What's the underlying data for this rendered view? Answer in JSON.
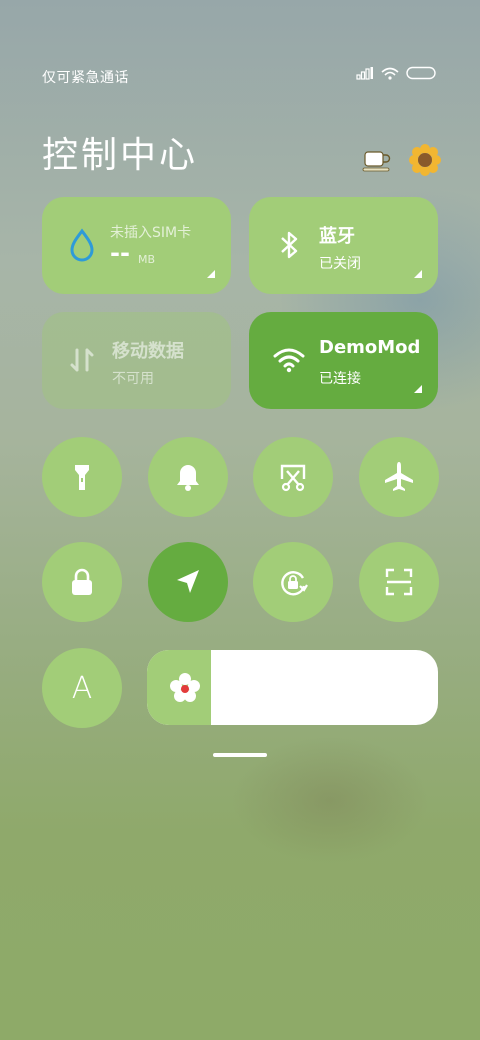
{
  "status_bar": {
    "carrier_text": "仅可紧急通话",
    "signal_icon": "signal-icon",
    "wifi_icon": "wifi-icon",
    "battery_icon": "battery-icon"
  },
  "header": {
    "title": "控制中心",
    "buttons": [
      {
        "icon": "tea-cup-icon"
      },
      {
        "icon": "settings-flower-icon"
      }
    ]
  },
  "tiles": {
    "data_usage": {
      "label": "未插入SIM卡",
      "value": "--",
      "unit": "MB",
      "icon": "water-drop-icon"
    },
    "bluetooth": {
      "label": "蓝牙",
      "status": "已关闭",
      "icon": "bluetooth-icon"
    },
    "mobile_data": {
      "label": "移动数据",
      "status": "不可用",
      "icon": "mobile-data-arrows-icon"
    },
    "wifi": {
      "label": "DemoMod",
      "status": "已连接",
      "icon": "wifi-icon"
    }
  },
  "toggles_row1": [
    {
      "name": "flashlight",
      "icon": "flashlight-icon",
      "active": false
    },
    {
      "name": "mute",
      "icon": "bell-icon",
      "active": false
    },
    {
      "name": "screenshot",
      "icon": "scissors-icon",
      "active": false
    },
    {
      "name": "airplane-mode",
      "icon": "airplane-icon",
      "active": false
    }
  ],
  "toggles_row2": [
    {
      "name": "lock-screen",
      "icon": "lock-icon",
      "active": false
    },
    {
      "name": "location",
      "icon": "location-arrow-icon",
      "active": true
    },
    {
      "name": "auto-rotate",
      "icon": "rotation-lock-icon",
      "active": false
    },
    {
      "name": "scanner",
      "icon": "scan-icon",
      "active": false
    }
  ],
  "toggles_row3": [
    {
      "name": "auto-brightness",
      "icon": "letter-a-icon",
      "text": "A",
      "active": false
    }
  ],
  "brightness": {
    "level": 0.22,
    "icon": "flower-brightness-icon"
  },
  "colors": {
    "tile": "#a2cd78",
    "tile_active": "#65ac40",
    "text": "#ffffff"
  }
}
